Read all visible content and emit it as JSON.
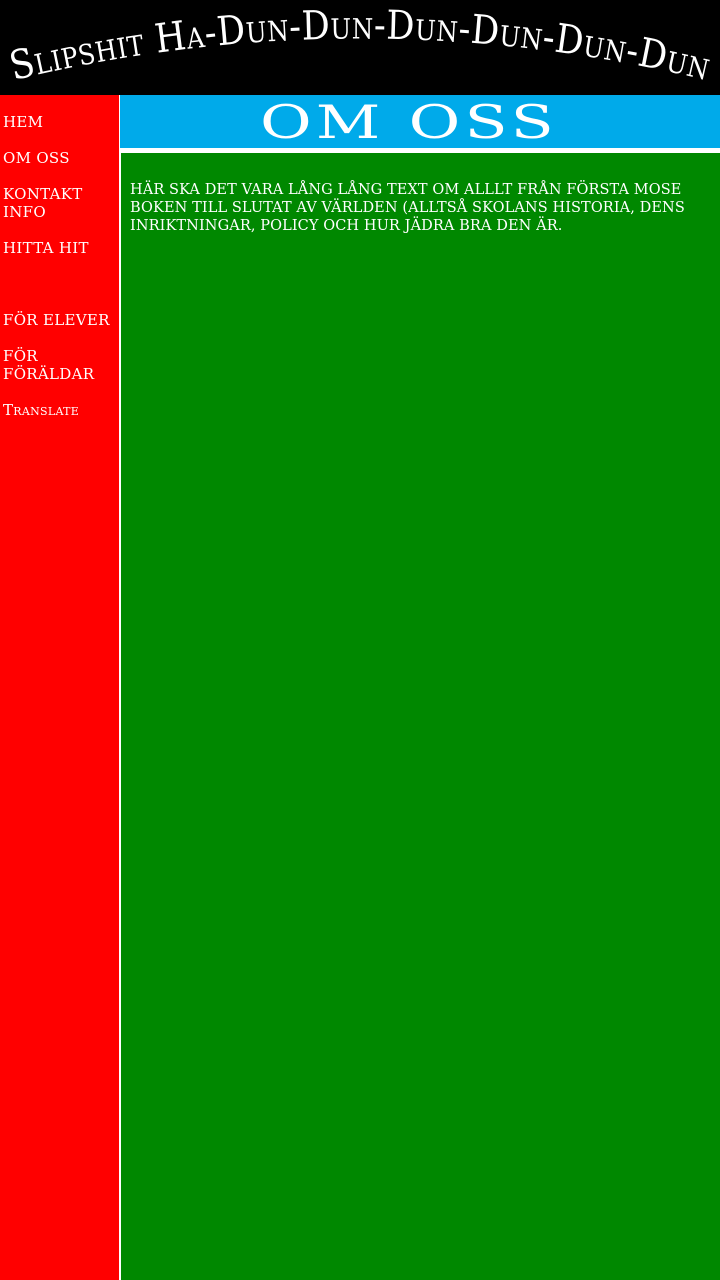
{
  "header": {
    "title": "Slipshit Ha-Dun-Dun-Dun-Dun-Dun-Dun"
  },
  "sidebar": {
    "items": [
      {
        "label": "HEM"
      },
      {
        "label": "OM OSS"
      },
      {
        "label": "KONTAKT INFO"
      },
      {
        "label": "HITTA HIT"
      },
      {
        "label": "FÖR ELEVER"
      },
      {
        "label": "FÖR FÖRÄLDAR"
      },
      {
        "label": "Translate"
      }
    ]
  },
  "page": {
    "title": "OM OSS"
  },
  "content": {
    "body": "HÄR SKA DET VARA LÅNG LÅNG TEXT OM ALLLT FRÅN FÖRSTA MOSE BOKEN TILL SLUTAT AV VÄRLDEN (ALLTSÅ SKOLANS HISTORIA, DENS INRIKTNINGAR, POLICY OCH HUR JÄDRA BRA DEN ÄR."
  },
  "colors": {
    "header_bg": "#000000",
    "sidebar_bg": "#ff0000",
    "title_bar_bg": "#00aaea",
    "content_bg": "#008800",
    "text": "#ffffff"
  }
}
